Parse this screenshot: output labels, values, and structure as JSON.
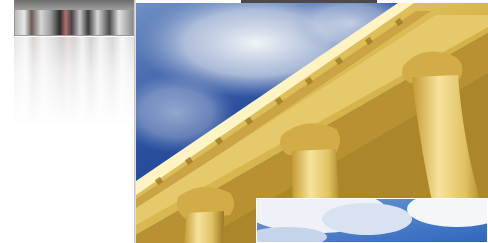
{
  "gallery": {
    "thumbnails": [
      {
        "name": "street-scene-thumbnail",
        "selected": true
      }
    ],
    "main_image": {
      "subject": "neoclassical-column-portico"
    },
    "next_image": {
      "subject": "sky-and-clouds"
    }
  },
  "colors": {
    "sky": "#1d3f8f",
    "stone": "#d8b74e",
    "panel_background": "#ffffff"
  }
}
